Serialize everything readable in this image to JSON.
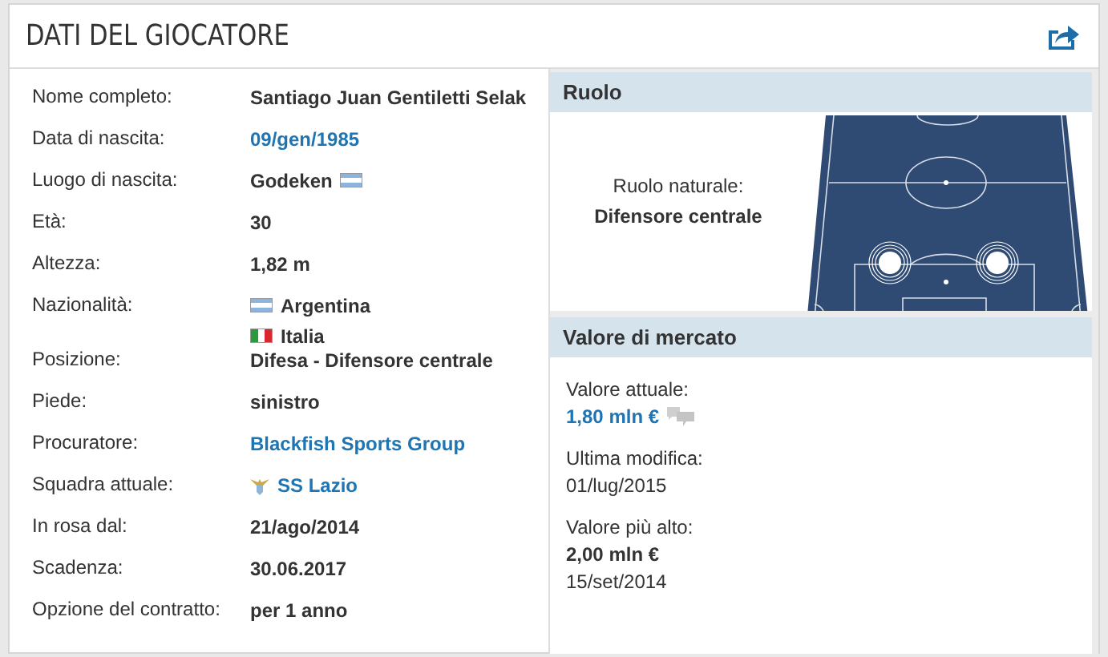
{
  "header": {
    "title": "DATI DEL GIOCATORE"
  },
  "info_rows": [
    {
      "label": "Nome completo:",
      "values": [
        {
          "text": "Santiago Juan Gentiletti Selak",
          "kind": "text"
        }
      ]
    },
    {
      "label": "Data di nascita:",
      "values": [
        {
          "text": "09/gen/1985",
          "kind": "link"
        }
      ]
    },
    {
      "label": "Luogo di nascita:",
      "values": [
        {
          "text": "Godeken",
          "kind": "text_flag_ar"
        }
      ]
    },
    {
      "label": "Età:",
      "values": [
        {
          "text": "30",
          "kind": "text"
        }
      ]
    },
    {
      "label": "Altezza:",
      "values": [
        {
          "text": "1,82 m",
          "kind": "text"
        }
      ]
    },
    {
      "label": "Nazionalità:",
      "values": [
        {
          "text": "Argentina",
          "kind": "flag_ar_text"
        },
        {
          "text": "Italia",
          "kind": "flag_it_text"
        }
      ]
    },
    {
      "label": "Posizione:",
      "values": [
        {
          "text": "Difesa - Difensore centrale",
          "kind": "text"
        }
      ]
    },
    {
      "label": "Piede:",
      "values": [
        {
          "text": "sinistro",
          "kind": "text"
        }
      ]
    },
    {
      "label": "Procuratore:",
      "values": [
        {
          "text": "Blackfish Sports Group",
          "kind": "link"
        }
      ]
    },
    {
      "label": "Squadra attuale:",
      "values": [
        {
          "text": "SS Lazio",
          "kind": "crest_link"
        }
      ]
    },
    {
      "label": "In rosa dal:",
      "values": [
        {
          "text": "21/ago/2014",
          "kind": "text"
        }
      ]
    },
    {
      "label": "Scadenza:",
      "values": [
        {
          "text": "30.06.2017",
          "kind": "text"
        }
      ]
    },
    {
      "label": "Opzione del contratto:",
      "values": [
        {
          "text": "per 1 anno",
          "kind": "text"
        }
      ]
    }
  ],
  "role": {
    "title": "Ruolo",
    "label": "Ruolo naturale:",
    "value": "Difensore centrale"
  },
  "market_value": {
    "title": "Valore di mercato",
    "items": [
      {
        "label": "Valore attuale:",
        "values": [
          {
            "text": "1,80 mln €",
            "kind": "link_note"
          }
        ]
      },
      {
        "label": "Ultima modifica:",
        "values": [
          {
            "text": "01/lug/2015",
            "kind": "plain"
          }
        ]
      },
      {
        "label": "Valore più alto:",
        "values": [
          {
            "text": "2,00 mln €",
            "kind": "bold"
          },
          {
            "text": "15/set/2014",
            "kind": "plain"
          }
        ]
      }
    ]
  }
}
